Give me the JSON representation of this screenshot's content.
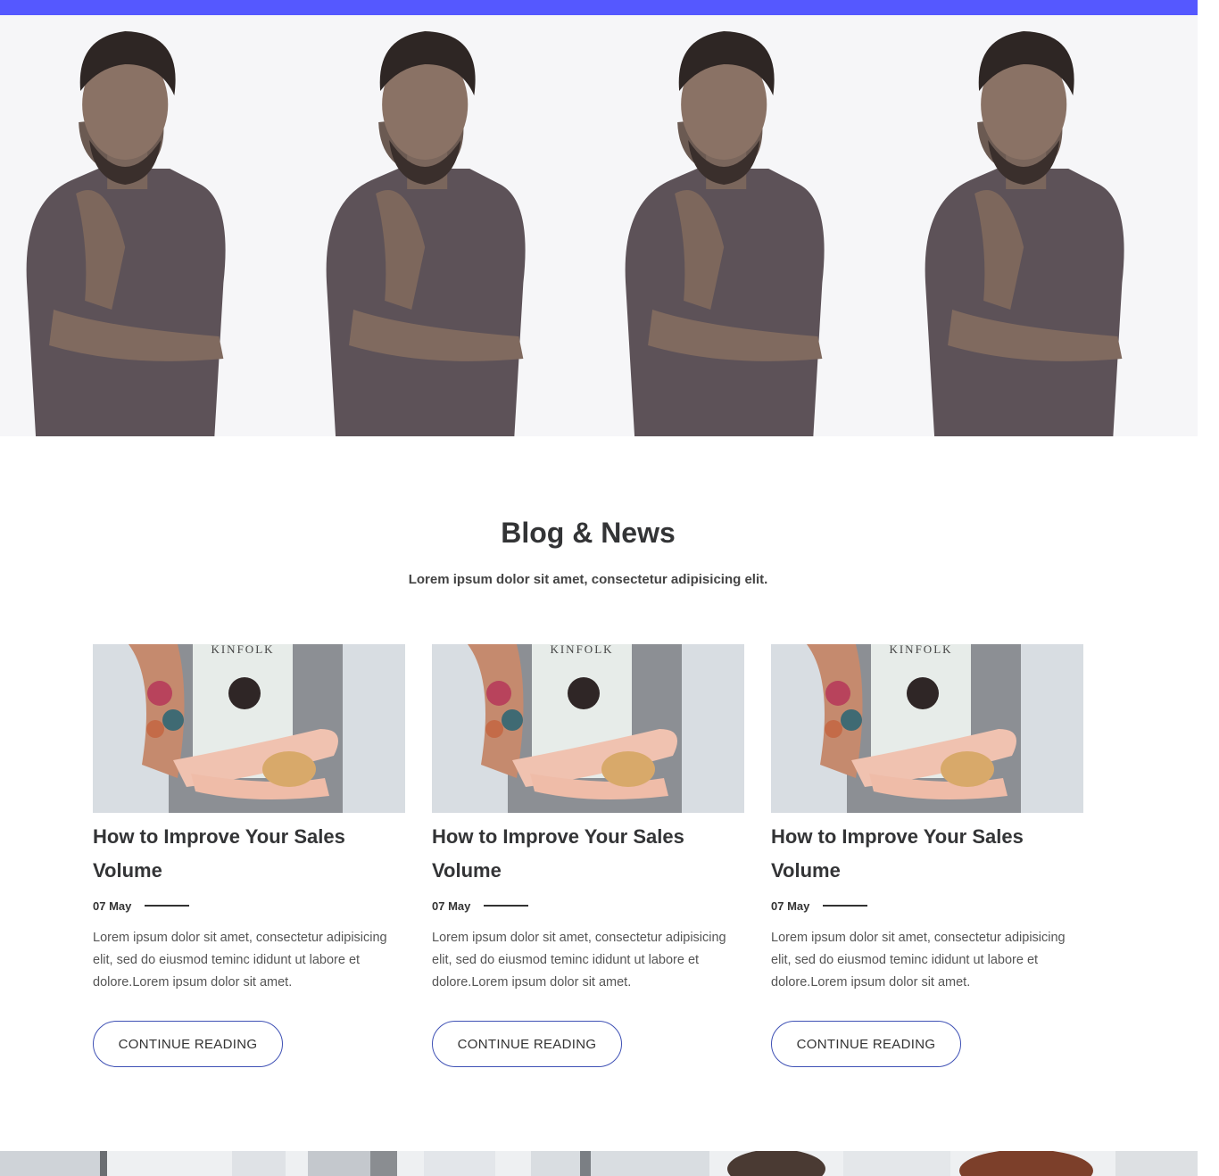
{
  "theme": {
    "accent": "#5558ff",
    "button_border": "#3f51b5",
    "heading": "#333436"
  },
  "team": {
    "photos": [
      {
        "image": "man-portrait-photo"
      },
      {
        "image": "man-portrait-photo"
      },
      {
        "image": "man-portrait-photo"
      },
      {
        "image": "man-portrait-photo"
      }
    ]
  },
  "blog": {
    "title": "Blog & News",
    "subtitle": "Lorem ipsum dolor sit amet, consectetur adipisicing elit.",
    "posts": [
      {
        "image_text": "KINFOLK",
        "title": "How to Improve Your Sales Volume",
        "date": "07 May",
        "excerpt": "Lorem ipsum dolor sit amet, consectetur adipisicing elit, sed do eiusmod teminc ididunt ut labore et dolore.Lorem ipsum dolor sit amet.",
        "button": "CONTINUE READING"
      },
      {
        "image_text": "KINFOLK",
        "title": "How to Improve Your Sales Volume",
        "date": "07 May",
        "excerpt": "Lorem ipsum dolor sit amet, consectetur adipisicing elit, sed do eiusmod teminc ididunt ut labore et dolore.Lorem ipsum dolor sit amet.",
        "button": "CONTINUE READING"
      },
      {
        "image_text": "KINFOLK",
        "title": "How to Improve Your Sales Volume",
        "date": "07 May",
        "excerpt": "Lorem ipsum dolor sit amet, consectetur adipisicing elit, sed do eiusmod teminc ididunt ut labore et dolore.Lorem ipsum dolor sit amet.",
        "button": "CONTINUE READING"
      }
    ]
  }
}
